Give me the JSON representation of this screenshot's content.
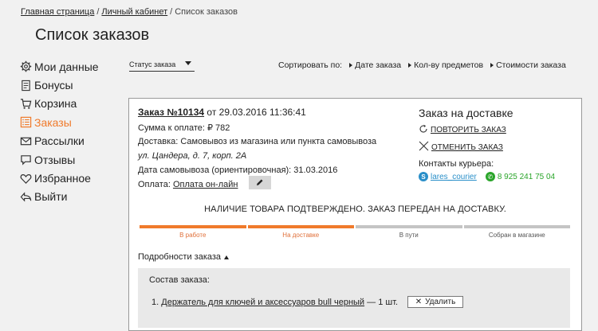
{
  "breadcrumb": {
    "home": "Главная страница",
    "cabinet": "Личный кабинет",
    "current": "Список заказов",
    "sep": "/"
  },
  "page_title": "Список заказов",
  "sidebar": {
    "items": [
      {
        "label": "Мои данные",
        "icon": "gear-icon"
      },
      {
        "label": "Бонусы",
        "icon": "document-icon"
      },
      {
        "label": "Корзина",
        "icon": "cart-icon"
      },
      {
        "label": "Заказы",
        "icon": "list-icon",
        "active": true
      },
      {
        "label": "Рассылки",
        "icon": "envelope-icon"
      },
      {
        "label": "Отзывы",
        "icon": "speech-bubble-icon"
      },
      {
        "label": "Избранное",
        "icon": "heart-icon"
      },
      {
        "label": "Выйти",
        "icon": "exit-icon"
      }
    ]
  },
  "filters": {
    "status_select": "Статус заказа",
    "sort_label": "Сортировать по:",
    "sort_options": [
      "Дате заказа",
      "Кол-ву предметов",
      "Стоимости заказа"
    ]
  },
  "order": {
    "title_prefix": "Заказ №10134",
    "title_suffix": "от 29.03.2016 11:36:41",
    "amount": "Сумма к оплате: ₽ 782",
    "delivery": "Доставка: Самовывоз из магазина или пункта самовывоза",
    "address": "ул. Цандера, д. 7, корп. 2А",
    "pickup_date": "Дата самовывоза (ориентировочная): 31.03.2016",
    "payment_label": "Оплата:",
    "payment_value": "Оплата он-лайн",
    "delivery_status_title": "Заказ на доставке",
    "repeat_order": "ПОВТОРИТЬ ЗАКАЗ",
    "cancel_order": "ОТМЕНИТЬ ЗАКАЗ",
    "courier_contacts_label": "Контакты курьера:",
    "courier_skype": "lares_courier",
    "courier_phone": "8 925 241 75 04",
    "status_message": "НАЛИЧИЕ ТОВАРА ПОДТВЕРЖДЕНО. ЗАКАЗ ПЕРЕДАН НА ДОСТАВКУ.",
    "progress": {
      "steps": [
        {
          "label": "В работе",
          "done": true
        },
        {
          "label": "На доставке",
          "done": true
        },
        {
          "label": "В пути",
          "done": false
        },
        {
          "label": "Собран в магазине",
          "done": false
        }
      ]
    },
    "details_toggle": "Подробности заказа",
    "composition_title": "Состав заказа:",
    "item": {
      "number": "1.",
      "name": "Держатель для ключей и аксессуаров bull черный",
      "qty": "— 1 шт."
    },
    "delete_label": "Удалить"
  },
  "colors": {
    "accent": "#f07a2b",
    "done_label": "#e0703a",
    "pending_bar": "#c4c4c4",
    "pending_label": "#555555",
    "skype": "#2a8fc9",
    "whatsapp": "#2aa52a"
  }
}
